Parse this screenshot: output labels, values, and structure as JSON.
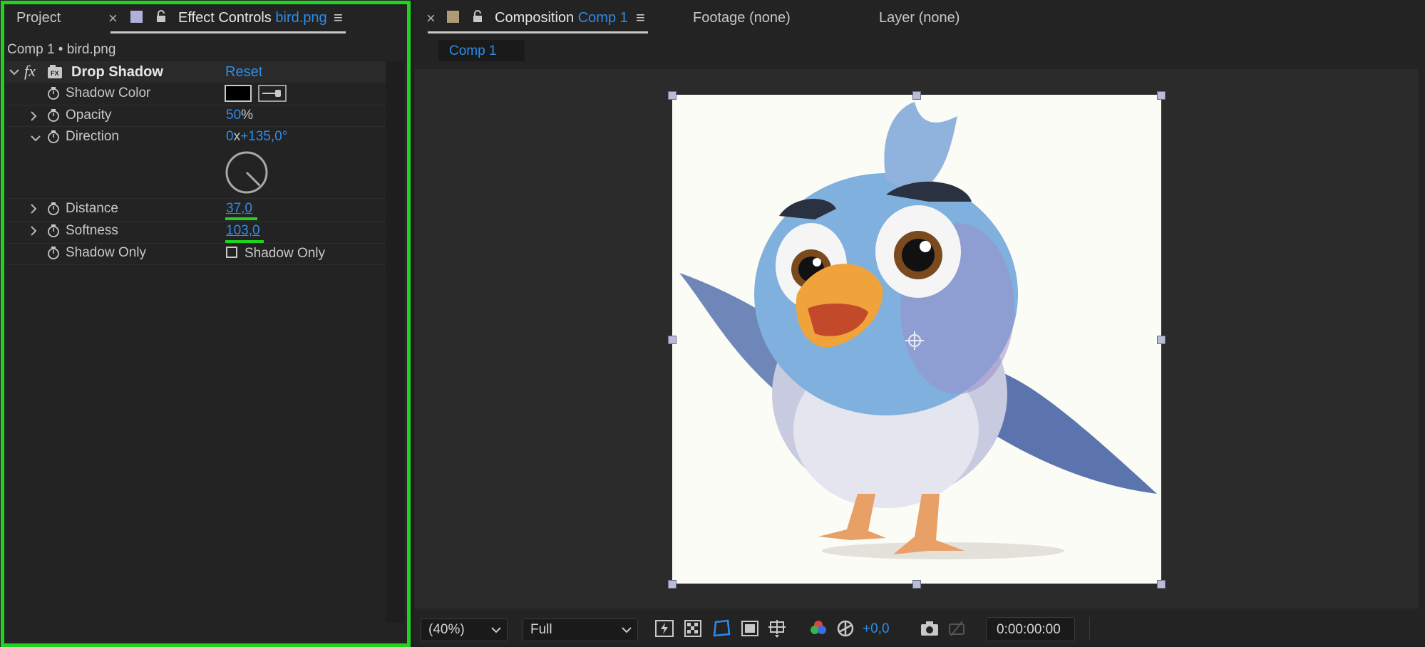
{
  "left_panel": {
    "tabs": {
      "project": "Project",
      "close_glyph": "×",
      "effect_controls_label": "Effect Controls",
      "effect_controls_file": "bird.png",
      "menu_glyph": "≡"
    },
    "breadcrumb": "Comp 1 • bird.png",
    "effect": {
      "fx_glyph": "fx",
      "name": "Drop Shadow",
      "reset": "Reset"
    },
    "properties": {
      "shadow_color_label": "Shadow Color",
      "shadow_color_value": "#000000",
      "opacity_label": "Opacity",
      "opacity_value": "50",
      "opacity_unit": "%",
      "direction_label": "Direction",
      "direction_rev": "0",
      "direction_x": "x",
      "direction_angle": "+135,0°",
      "direction_degrees": 135,
      "distance_label": "Distance",
      "distance_value": "37,0",
      "softness_label": "Softness",
      "softness_value": "103,0",
      "shadow_only_label": "Shadow Only",
      "shadow_only_checkbox_label": "Shadow Only",
      "shadow_only_checked": false
    }
  },
  "right_panel": {
    "tabs": {
      "close_glyph": "×",
      "composition_label": "Composition",
      "composition_name": "Comp 1",
      "menu_glyph": "≡",
      "footage": "Footage (none)",
      "layer": "Layer (none)"
    },
    "comp_subtab": "Comp 1",
    "bottom_bar": {
      "zoom": "(40%)",
      "resolution": "Full",
      "exposure": "+0,0",
      "timecode": "0:00:00:00"
    }
  },
  "colors": {
    "accent": "#2d8ceb",
    "highlight": "#1ed41e",
    "panel_bg": "#232323"
  },
  "icons": [
    "stopwatch-icon",
    "chevron-right-icon",
    "chevron-down-icon",
    "eyedropper-icon",
    "lock-icon",
    "camera-icon",
    "color-channels-icon",
    "exposure-icon",
    "grid-icon",
    "mask-icon",
    "region-icon",
    "target-icon",
    "snapshot-icon"
  ]
}
